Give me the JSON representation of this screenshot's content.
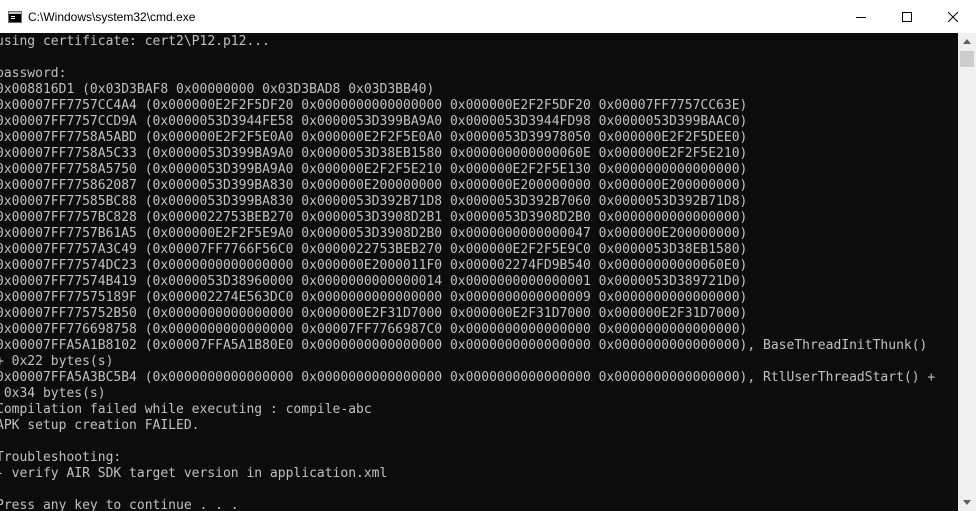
{
  "window": {
    "title": "C:\\Windows\\system32\\cmd.exe",
    "icon": "cmd-console-icon",
    "controls": [
      "minimize-icon",
      "maximize-icon",
      "close-icon"
    ]
  },
  "colors": {
    "console_background": "#0c0c0c",
    "console_text": "#c0c0c0",
    "titlebar_background": "#ffffff",
    "scrollbar_track": "#f0f0f0",
    "scrollbar_thumb": "#cdcdcd"
  },
  "console": {
    "lines": [
      "using certificate: cert2\\P12.p12...",
      "",
      "password:",
      "0x008816D1 (0x03D3BAF8 0x00000000 0x03D3BAD8 0x03D3BB40)",
      "0x00007FF7757CC4A4 (0x000000E2F2F5DF20 0x0000000000000000 0x000000E2F2F5DF20 0x00007FF7757CC63E)",
      "0x00007FF7757CCD9A (0x0000053D3944FE58 0x0000053D399BA9A0 0x0000053D3944FD98 0x0000053D399BAAC0)",
      "0x00007FF7758A5ABD (0x000000E2F2F5E0A0 0x000000E2F2F5E0A0 0x0000053D39978050 0x000000E2F2F5DEE0)",
      "0x00007FF7758A5C33 (0x0000053D399BA9A0 0x0000053D38EB1580 0x000000000000060E 0x000000E2F2F5E210)",
      "0x00007FF7758A5750 (0x0000053D399BA9A0 0x000000E2F2F5E210 0x000000E2F2F5E130 0x0000000000000000)",
      "0x00007FF775862087 (0x0000053D399BA830 0x000000E200000000 0x000000E200000000 0x000000E200000000)",
      "0x00007FF77585BC88 (0x0000053D399BA830 0x0000053D392B71D8 0x0000053D392B7060 0x0000053D392B71D8)",
      "0x00007FF7757BC828 (0x0000022753BEB270 0x0000053D3908D2B1 0x0000053D3908D2B0 0x0000000000000000)",
      "0x00007FF7757B61A5 (0x000000E2F2F5E9A0 0x0000053D3908D2B0 0x0000000000000047 0x000000E200000000)",
      "0x00007FF7757A3C49 (0x00007FF7766F56C0 0x0000022753BEB270 0x000000E2F2F5E9C0 0x0000053D38EB1580)",
      "0x00007FF77574DC23 (0x0000000000000000 0x000000E2000011F0 0x000002274FD9B540 0x00000000000060E0)",
      "0x00007FF77574B419 (0x0000053D38960000 0x0000000000000014 0x0000000000000001 0x0000053D389721D0)",
      "0x00007FF77575189F (0x000002274E563DC0 0x0000000000000000 0x0000000000000009 0x0000000000000000)",
      "0x00007FF775752B50 (0x0000000000000000 0x000000E2F31D7000 0x000000E2F31D7000 0x000000E2F31D7000)",
      "0x00007FF776698758 (0x0000000000000000 0x00007FF7766987C0 0x0000000000000000 0x0000000000000000)",
      "0x00007FFA5A1B8102 (0x00007FFA5A1B80E0 0x0000000000000000 0x0000000000000000 0x0000000000000000), BaseThreadInitThunk()",
      "+ 0x22 bytes(s)",
      "0x00007FFA5A3BC5B4 (0x0000000000000000 0x0000000000000000 0x0000000000000000 0x0000000000000000), RtlUserThreadStart() +",
      " 0x34 bytes(s)",
      "Compilation failed while executing : compile-abc",
      "APK setup creation FAILED.",
      "",
      "Troubleshooting:",
      "- verify AIR SDK target version in application.xml",
      "",
      "Press any key to continue . . ."
    ]
  },
  "scrollbar": {
    "up_arrow": "scroll-up-arrow-icon",
    "down_arrow": "scroll-down-arrow-icon"
  }
}
